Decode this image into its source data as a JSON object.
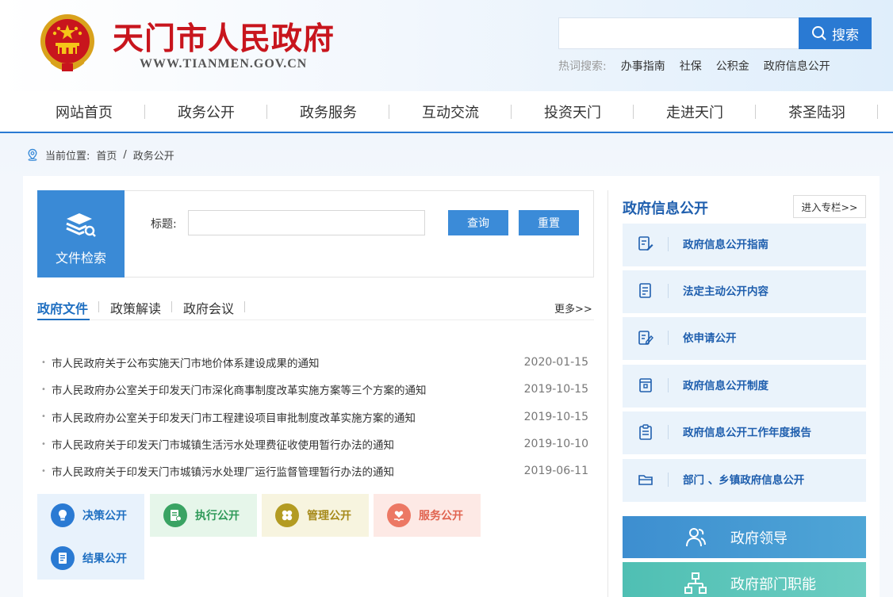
{
  "header": {
    "site_name": "天门市人民政府",
    "site_url": "WWW.TIANMEN.GOV.CN",
    "search_placeholder": "",
    "search_button": "搜索",
    "hot_label": "热词搜索:",
    "hot_words": [
      "办事指南",
      "社保",
      "公积金",
      "政府信息公开"
    ]
  },
  "nav": {
    "items": [
      "网站首页",
      "政务公开",
      "政务服务",
      "互动交流",
      "投资天门",
      "走进天门",
      "茶圣陆羽"
    ]
  },
  "breadcrumb": {
    "prefix": "当前位置:",
    "home": "首页",
    "separator": "/",
    "current": "政务公开"
  },
  "file_search": {
    "tile_label": "文件检索",
    "field_label": "标题:",
    "query_button": "查询",
    "reset_button": "重置"
  },
  "tabs": {
    "items": [
      "政府文件",
      "政策解读",
      "政府会议"
    ],
    "active_index": 0,
    "more": "更多>>"
  },
  "documents": [
    {
      "title": "市人民政府关于公布实施天门市地价体系建设成果的通知",
      "date": "2020-01-15"
    },
    {
      "title": "市人民政府办公室关于印发天门市深化商事制度改革实施方案等三个方案的通知",
      "date": "2019-10-15"
    },
    {
      "title": "市人民政府办公室关于印发天门市工程建设项目审批制度改革实施方案的通知",
      "date": "2019-10-15"
    },
    {
      "title": "市人民政府关于印发天门市城镇生活污水处理费征收使用暂行办法的通知",
      "date": "2019-10-10"
    },
    {
      "title": "市人民政府关于印发天门市城镇污水处理厂运行监督管理暂行办法的通知",
      "date": "2019-06-11"
    }
  ],
  "categories": [
    {
      "label": "决策公开",
      "icon": "lightbulb-icon",
      "color": "#1f6fc1",
      "bg": "#e8f2fc",
      "icon_bg": "#2a7ad3"
    },
    {
      "label": "执行公开",
      "icon": "document-icon",
      "color": "#2f9a59",
      "bg": "#e6f6ea",
      "icon_bg": "#3aa363"
    },
    {
      "label": "管理公开",
      "icon": "clover-icon",
      "color": "#a68a1a",
      "bg": "#f7f4df",
      "icon_bg": "#b39b22"
    },
    {
      "label": "服务公开",
      "icon": "heart-hand-icon",
      "color": "#e0634f",
      "bg": "#fde9e5",
      "icon_bg": "#ec7864"
    },
    {
      "label": "结果公开",
      "icon": "receipt-icon",
      "color": "#1f6fc1",
      "bg": "#e8f2fc",
      "icon_bg": "#2a7ad3"
    }
  ],
  "right": {
    "title": "政府信息公开",
    "enter_button": "进入专栏>>",
    "items": [
      {
        "label": "政府信息公开指南",
        "icon": "edit-doc-icon"
      },
      {
        "label": "法定主动公开内容",
        "icon": "doc-lines-icon"
      },
      {
        "label": "依申请公开",
        "icon": "pen-doc-icon"
      },
      {
        "label": "政府信息公开制度",
        "icon": "archive-icon"
      },
      {
        "label": "政府信息公开工作年度报告",
        "icon": "clipboard-icon"
      },
      {
        "label": "部门 、乡镇政府信息公开",
        "icon": "folder-icon"
      }
    ],
    "banners": [
      {
        "label": "政府领导",
        "icon": "people-icon",
        "bg": "#3d9ad0"
      },
      {
        "label": "政府部门职能",
        "icon": "org-chart-icon",
        "bg": "#58c2b8"
      }
    ]
  },
  "colors": {
    "brand_red": "#c8151d",
    "primary_blue": "#2a7ad3",
    "title_blue": "#1f5fae"
  }
}
